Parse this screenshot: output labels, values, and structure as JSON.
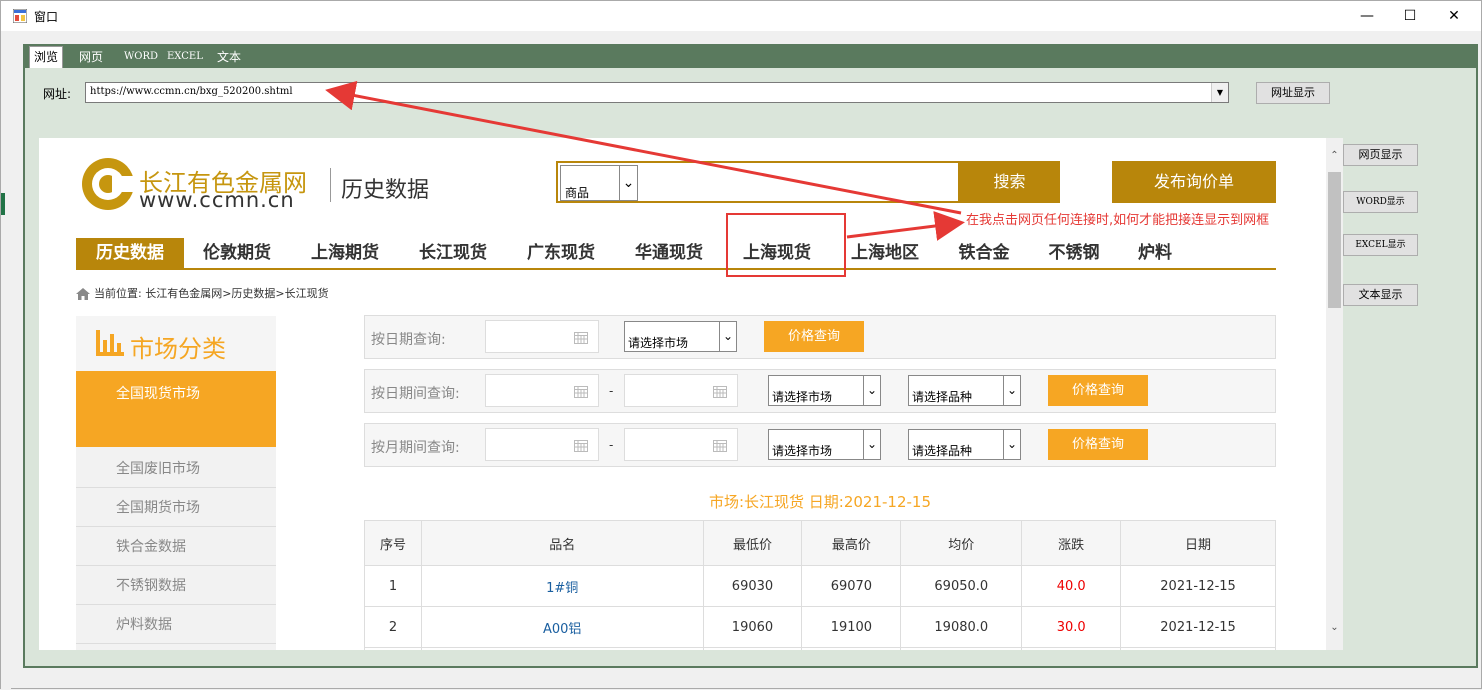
{
  "window": {
    "title": "窗口",
    "min_glyph": "—",
    "max_glyph": "☐",
    "close_glyph": "✕"
  },
  "tabs": [
    "浏览",
    "网页",
    "WORD",
    "EXCEL",
    "文本"
  ],
  "url_bar": {
    "label": "网址:",
    "value": "https://www.ccmn.cn/bxg_520200.shtml",
    "show_button": "网址显示"
  },
  "side_buttons": [
    "网页显示",
    "WORD显示",
    "EXCEL显示",
    "文本显示"
  ],
  "webpage": {
    "site_name": "长江有色金属网",
    "site_url": "www.ccmn.cn",
    "subtitle": "历史数据",
    "search": {
      "category": "商品",
      "button": "搜索"
    },
    "post_button": "发布询价单",
    "nav": [
      "历史数据",
      "伦敦期货",
      "上海期货",
      "长江现货",
      "广东现货",
      "华通现货",
      "上海现货",
      "上海地区",
      "铁合金",
      "不锈钢",
      "炉料"
    ],
    "breadcrumb": "当前位置: 长江有色金属网>历史数据>长江现货",
    "sidebar": {
      "title": "市场分类",
      "active": "全国现货市场",
      "items": [
        "全国废旧市场",
        "全国期货市场",
        "铁合金数据",
        "不锈钢数据",
        "炉料数据"
      ]
    },
    "queries": [
      {
        "label": "按日期查询:",
        "market": "请选择市场",
        "button": "价格查询"
      },
      {
        "label": "按日期间查询:",
        "dash": "-",
        "market": "请选择市场",
        "variety": "请选择品种",
        "button": "价格查询"
      },
      {
        "label": "按月期间查询:",
        "dash": "-",
        "market": "请选择市场",
        "variety": "请选择品种",
        "button": "价格查询"
      }
    ],
    "market_info": "市场:长江现货   日期:2021-12-15",
    "table": {
      "headers": [
        "序号",
        "品名",
        "最低价",
        "最高价",
        "均价",
        "涨跌",
        "日期"
      ],
      "rows": [
        [
          "1",
          "1#铜",
          "69030",
          "69070",
          "69050.0",
          "40.0",
          "2021-12-15"
        ],
        [
          "2",
          "A00铝",
          "19060",
          "19100",
          "19080.0",
          "30.0",
          "2021-12-15"
        ]
      ]
    }
  },
  "annotation": "在我点击网页任何连接时,如何才能把接连显示到网框",
  "colors": {
    "gold": "#b8860b",
    "orange": "#f6a623",
    "annotation_red": "#e53935",
    "tab_green": "#5a7a5e",
    "page_bg": "#dae5da"
  }
}
